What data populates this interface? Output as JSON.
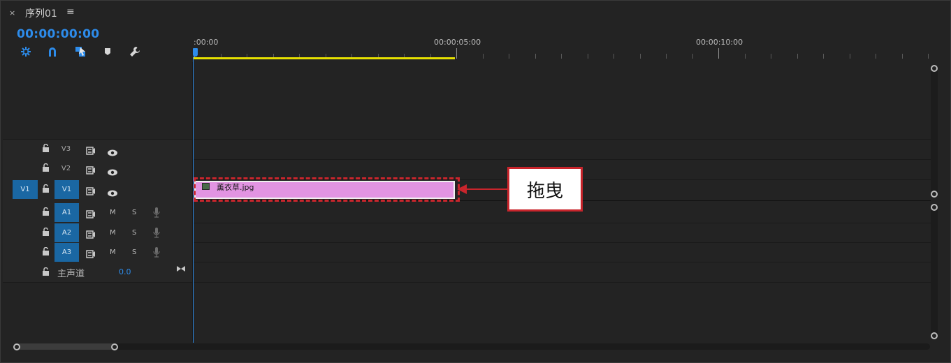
{
  "panel": {
    "close_label": "×",
    "title": "序列01",
    "menu_label": "≡"
  },
  "timecode": "00:00:00:00",
  "tools": [
    {
      "name": "nest-icon",
      "label": "✲"
    },
    {
      "name": "snap-icon",
      "label": "∩"
    },
    {
      "name": "linked-selection-icon",
      "label": "◩"
    },
    {
      "name": "marker-icon",
      "label": "⬟"
    },
    {
      "name": "wrench-icon",
      "label": "🔧"
    }
  ],
  "ruler": {
    "labels": [
      ":00:00",
      "00:00:05:00",
      "00:00:10:00"
    ]
  },
  "video_tracks": [
    {
      "lock": "🔓",
      "name": "V3",
      "sync": "⊟",
      "eye": "👁"
    },
    {
      "lock": "🔓",
      "name": "V2",
      "sync": "⊟",
      "eye": "👁"
    },
    {
      "lock": "🔓",
      "name": "V1",
      "sync": "⊟",
      "eye": "👁"
    }
  ],
  "source_patch": "V1",
  "audio_tracks": [
    {
      "lock": "🔓",
      "name": "A1",
      "sync": "⊟",
      "mute": "M",
      "solo": "S",
      "mic": "🎙"
    },
    {
      "lock": "🔓",
      "name": "A2",
      "sync": "⊟",
      "mute": "M",
      "solo": "S",
      "mic": "🎙"
    },
    {
      "lock": "🔓",
      "name": "A3",
      "sync": "⊟",
      "mute": "M",
      "solo": "S",
      "mic": "🎙"
    }
  ],
  "master": {
    "lock": "🔓",
    "label": "主声道",
    "value": "0.0",
    "end_icon": "⧓"
  },
  "clip": {
    "name": "薰衣草.jpg"
  },
  "callout": {
    "text": "拖曳"
  },
  "colors": {
    "accent": "#2d8ceb",
    "clip": "#e294e2",
    "work_area": "#e6e000",
    "annotation": "#c9252c",
    "track_target": "#1a67a3"
  }
}
